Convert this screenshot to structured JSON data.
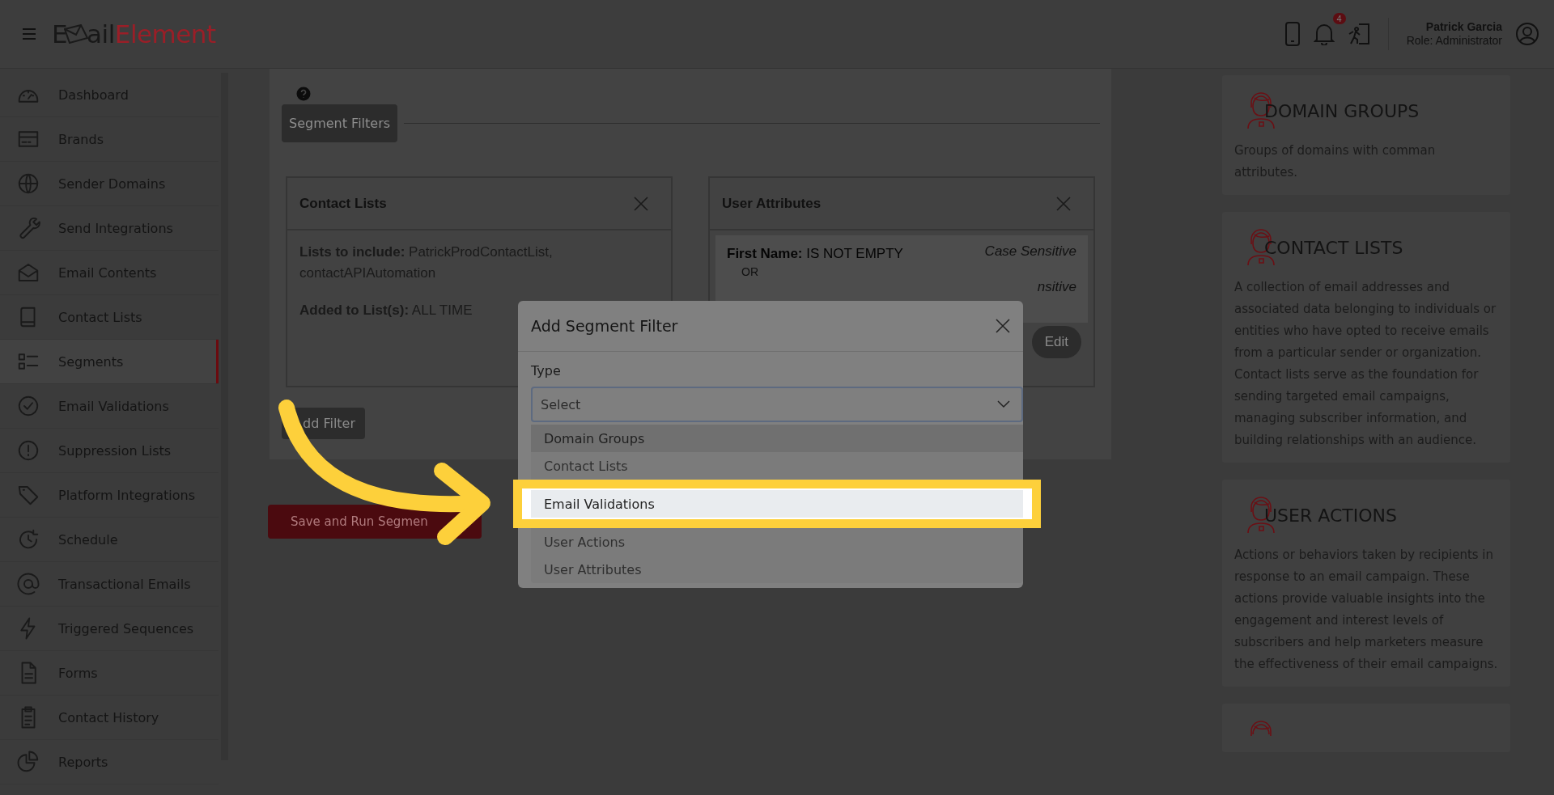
{
  "header": {
    "logo": {
      "letter": "E",
      "rest": "ail",
      "accent": "Element"
    },
    "notification_count": "4",
    "user": {
      "name": "Patrick Garcia",
      "role": "Role: Administrator"
    }
  },
  "sidebar": {
    "items": [
      {
        "label": "Dashboard",
        "selected": false
      },
      {
        "label": "Brands",
        "selected": false
      },
      {
        "label": "Sender Domains",
        "selected": false
      },
      {
        "label": "Send Integrations",
        "selected": false
      },
      {
        "label": "Email Contents",
        "selected": false
      },
      {
        "label": "Contact Lists",
        "selected": false
      },
      {
        "label": "Segments",
        "selected": true
      },
      {
        "label": "Email Validations",
        "selected": false
      },
      {
        "label": "Suppression Lists",
        "selected": false
      },
      {
        "label": "Platform Integrations",
        "selected": false
      },
      {
        "label": "Schedule",
        "selected": false
      },
      {
        "label": "Transactional Emails",
        "selected": false
      },
      {
        "label": "Triggered Sequences",
        "selected": false
      },
      {
        "label": "Forms",
        "selected": false
      },
      {
        "label": "Contact History",
        "selected": false
      },
      {
        "label": "Reports",
        "selected": false
      }
    ]
  },
  "main": {
    "section_button": "Segment Filters",
    "filter_cards": [
      {
        "kind": "lists",
        "title": "Contact Lists",
        "lines": [
          "**Lists to include:** PatrickProdContactList, contactAPIAutomation",
          "**Added to List(s):**  ALL TIME"
        ]
      },
      {
        "kind": "attributes",
        "title": "User Attributes",
        "conditions": [
          {
            "text": "**First Name:** IS NOT EMPTY",
            "note": "Case Sensitive"
          },
          {
            "note": "nsitive"
          }
        ],
        "separator": "OR",
        "edit": "Edit"
      }
    ],
    "add_filter": "dd Filter",
    "save": "Save and Run Segmen"
  },
  "modal": {
    "title": "Add Segment Filter",
    "field_label": "Type",
    "placeholder": "Select",
    "options": [
      {
        "label": "Domain Groups",
        "selected": true,
        "spotlight": false
      },
      {
        "label": "Contact Lists",
        "selected": false,
        "spotlight": false
      },
      {
        "label": "Email Validations",
        "selected": false,
        "spotlight": true
      },
      {
        "label": "User Actions",
        "selected": false,
        "spotlight": false
      },
      {
        "label": "User Attributes",
        "selected": false,
        "spotlight": false
      }
    ]
  },
  "info_cards": [
    {
      "title": "DOMAIN GROUPS",
      "text": "Groups of domains with comman attributes."
    },
    {
      "title": "CONTACT LISTS",
      "text": "A collection of email addresses and associated data belonging to individuals or entities who have opted to receive emails from a particular sender or organization. Contact lists serve as the foundation for sending targeted email campaigns, managing subscriber information, and building relationships with an audience."
    },
    {
      "title": "USER ACTIONS",
      "text": "Actions or behaviors taken by recipients in response to an email campaign. These actions provide valuable insights into the engagement and interest levels of subscribers and help marketers measure the effectiveness of their email campaigns."
    }
  ]
}
